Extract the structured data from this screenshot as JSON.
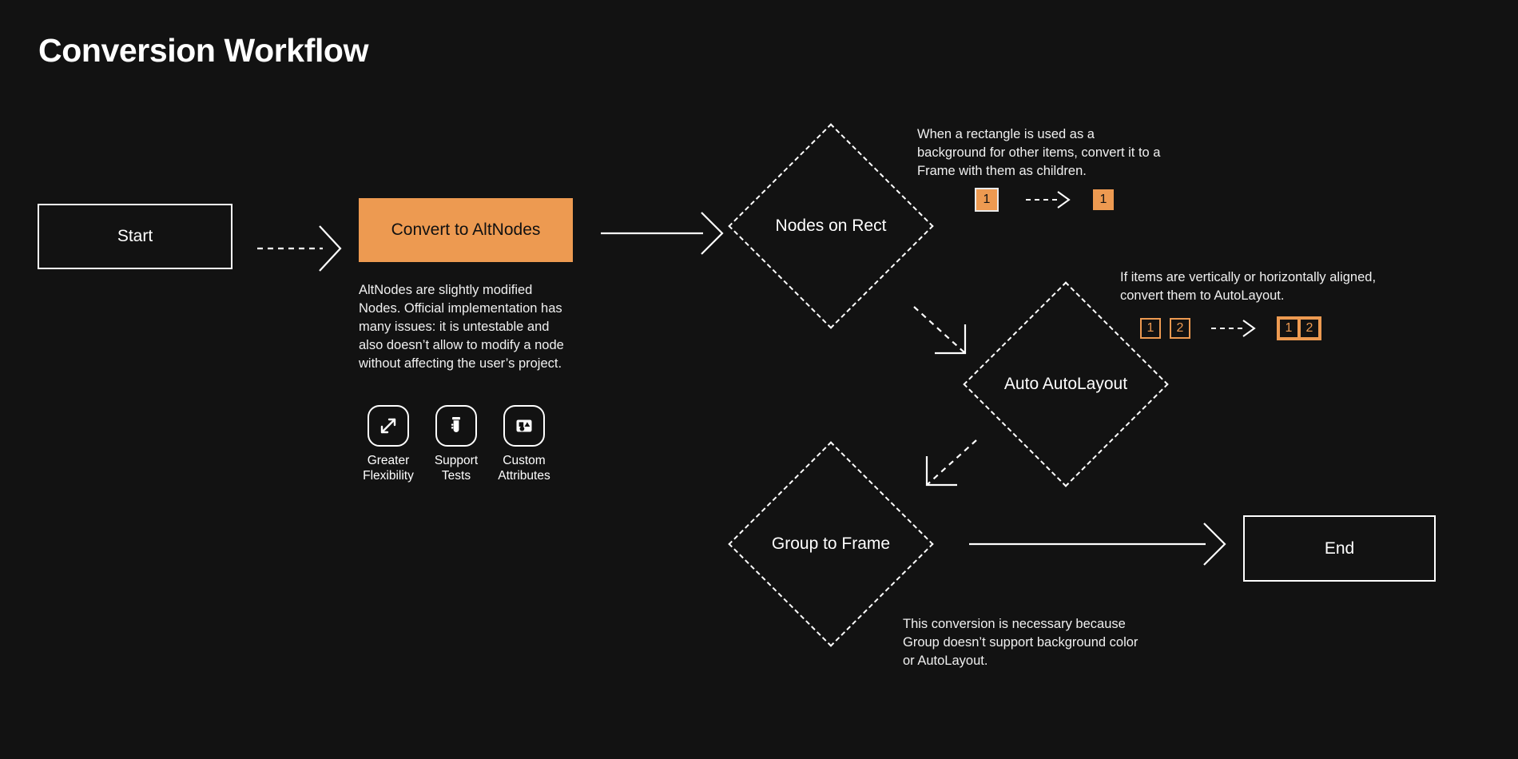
{
  "title": "Conversion Workflow",
  "colors": {
    "background": "#121212",
    "accent_orange": "#ED9A51",
    "stroke_white": "#ffffff",
    "text_white": "#f0f0f0"
  },
  "nodes": {
    "start": {
      "label": "Start"
    },
    "convert": {
      "label": "Convert to AltNodes",
      "description": "AltNodes are slightly modified Nodes. Official implementation has many issues: it is untestable and also doesn’t allow to modify a node without affecting the user’s project."
    },
    "nodes_on_rect": {
      "label": "Nodes on Rect"
    },
    "auto_autolayout": {
      "label": "Auto AutoLayout"
    },
    "group_to_frame": {
      "label": "Group to Frame"
    },
    "end": {
      "label": "End"
    }
  },
  "features": [
    {
      "icon": "expand-arrows-icon",
      "label": "Greater\nFlexibility"
    },
    {
      "icon": "test-tube-icon",
      "label": "Support\nTests"
    },
    {
      "icon": "shapes-in-box-icon",
      "label": "Custom\nAttributes"
    }
  ],
  "annotations": {
    "nodes_on_rect": {
      "text": "When a rectangle is used as a background for other items, convert it to a Frame with them as children.",
      "before_chips": [
        "1"
      ],
      "after_chips": [
        "1"
      ]
    },
    "auto_autolayout": {
      "text": "If items are vertically or horizontally aligned, convert them to AutoLayout.",
      "before_chips": [
        "1",
        "2"
      ],
      "after_chips": [
        "1",
        "2"
      ]
    },
    "group_to_frame": {
      "text": "This conversion is necessary because Group doesn’t support background color or AutoLayout."
    }
  },
  "connectors": [
    {
      "name": "start-to-convert",
      "style": "dashed"
    },
    {
      "name": "convert-to-nodes-on-rect",
      "style": "solid"
    },
    {
      "name": "nodes-on-rect-to-auto-autolayout",
      "style": "dashed"
    },
    {
      "name": "auto-autolayout-to-group-to-frame",
      "style": "dashed"
    },
    {
      "name": "group-to-frame-to-end",
      "style": "solid"
    },
    {
      "name": "chip-transform-1",
      "style": "dashed"
    },
    {
      "name": "chip-transform-2",
      "style": "dashed"
    }
  ]
}
